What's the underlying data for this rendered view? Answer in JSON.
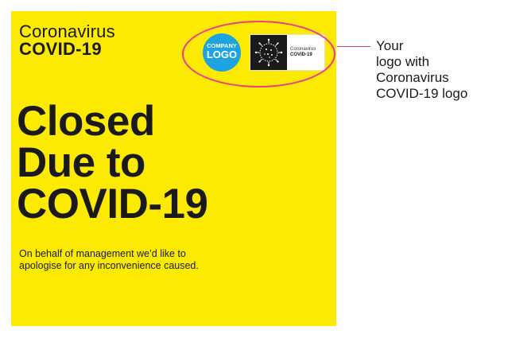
{
  "poster": {
    "header_line1": "Coronavirus",
    "header_line2": "COVID-19",
    "headline": [
      "Closed",
      "Due to",
      "COVID-19"
    ],
    "body": [
      "On behalf of management we’d like to",
      "apologise for any inconvenience caused."
    ],
    "background_color": "#fcea00"
  },
  "logos": {
    "company_logo_small": "COMPANY",
    "company_logo_big": "LOGO",
    "company_logo_color": "#1da4e0",
    "covid_badge_line1": "Coronavirus",
    "covid_badge_line2": "COVID-19",
    "covid_badge_icon": "virus-icon"
  },
  "callout": {
    "lines": [
      "Your",
      "logo with",
      "Coronavirus",
      "COVID-19 logo"
    ],
    "highlight_color": "#e83e8c"
  }
}
